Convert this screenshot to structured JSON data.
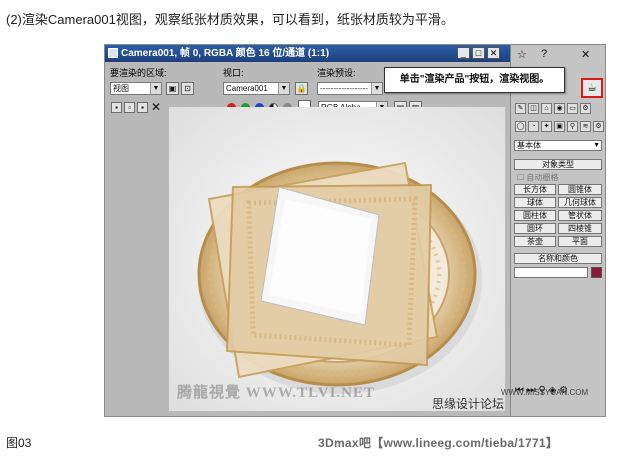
{
  "caption": "(2)渲染Camera001视图，观察纸张材质效果，可以看到，纸张材质较为平滑。",
  "figure_label": "图03",
  "footer": "3Dmax吧【www.lineeg.com/tieba/1771】",
  "render_window": {
    "title": "Camera001, 帧 0, RGBA 颜色 16 位/通道 (1:1)",
    "area_label": "要渲染的区域:",
    "area_value": "视图",
    "viewport_label": "视口:",
    "viewport_value": "Camera001",
    "preset_label": "渲染预设:",
    "preset_value": "------------------",
    "channel_value": "RGB Alpha",
    "close_glyph": "✕"
  },
  "callout": "单击\"渲染产品\"按钮，渲染视图。",
  "command_panel": {
    "category": "基本体",
    "rollout_object_type": "对象类型",
    "autogrid": "自动栅格",
    "buttons": [
      "长方体",
      "圆锥体",
      "球体",
      "几何球体",
      "圆柱体",
      "管状体",
      "圆环",
      "四棱锥",
      "茶壶",
      "平面"
    ],
    "rollout_name_color": "名称和颜色"
  },
  "colors": {
    "title_bar": "#1d3f7a",
    "highlight": "#d61c1c",
    "swatch": "#8b1a3a"
  },
  "watermarks": {
    "tlvi": "腾龍視覺 WWW.TLVI.NET",
    "forum": "思缘设计论坛",
    "missyuan": "WWW.MISSYUAN.COM"
  }
}
